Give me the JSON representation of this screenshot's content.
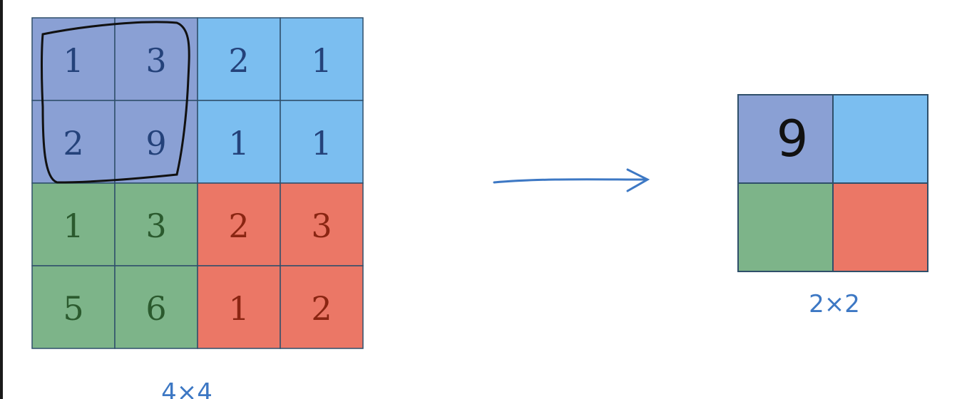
{
  "input_matrix": {
    "label": "4×4",
    "values": [
      [
        1,
        3,
        2,
        1
      ],
      [
        2,
        9,
        1,
        1
      ],
      [
        1,
        3,
        2,
        3
      ],
      [
        5,
        6,
        1,
        2
      ]
    ]
  },
  "output_matrix": {
    "label": "2×2",
    "values": [
      [
        "9",
        "",
        "",
        ""
      ]
    ]
  },
  "colors": {
    "quadrant_top_left": "#8aa0d4",
    "quadrant_top_right": "#7bbef0",
    "quadrant_bottom_left": "#7db489",
    "quadrant_bottom_right": "#eb7766",
    "text_top": "#24427a",
    "text_bottom_left": "#2b5a2e",
    "text_bottom_right": "#8a2512",
    "handwriting": "#3d78c4"
  }
}
